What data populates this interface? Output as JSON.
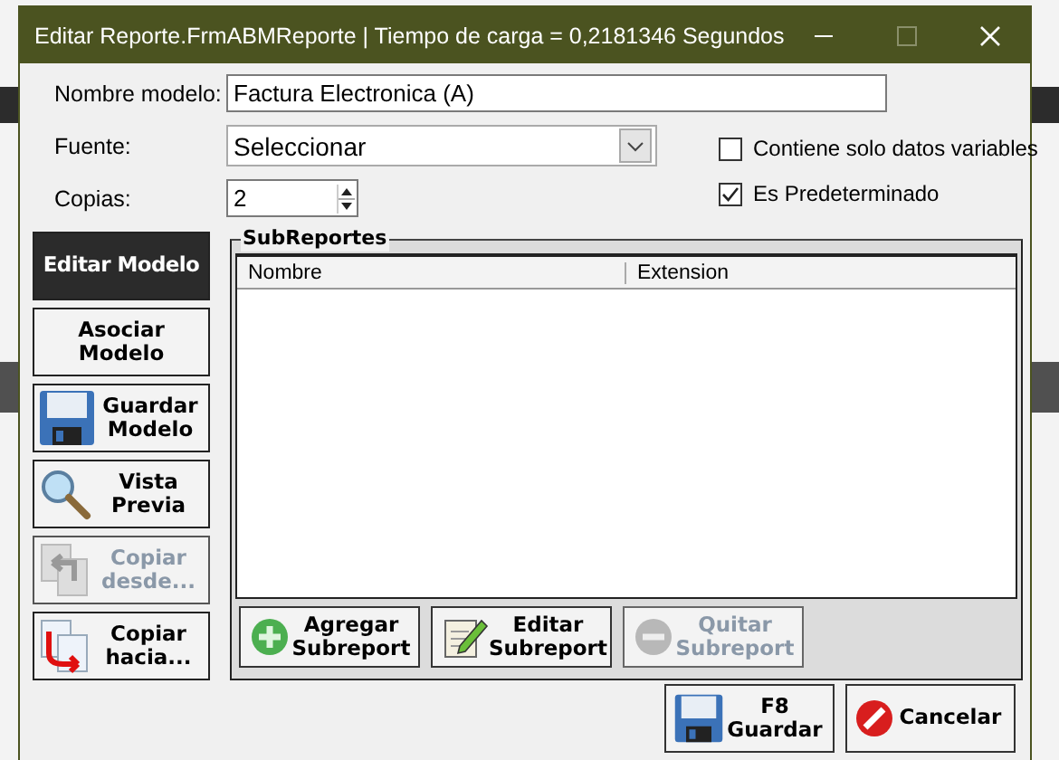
{
  "window": {
    "title": "Editar Reporte.FrmABMReporte | Tiempo de carga = 0,2181346 Segundos"
  },
  "fields": [
    {
      "kind": "text",
      "label": "Nombre modelo:",
      "value": "Factura Electronica (A)"
    },
    {
      "kind": "select",
      "label": "Fuente:",
      "value": "Seleccionar"
    },
    {
      "kind": "spin",
      "label": "Copias:",
      "value": "2"
    }
  ],
  "checkboxes": [
    {
      "label": "Contiene solo datos variables",
      "checked": false
    },
    {
      "label": "Es Predeterminado",
      "checked": true
    }
  ],
  "side_buttons": [
    {
      "label": "Editar Modelo",
      "kind": "plain",
      "selected": true,
      "disabled": false
    },
    {
      "label": "Asociar\nModelo",
      "kind": "plain",
      "selected": false,
      "disabled": false
    },
    {
      "label": "Guardar\nModelo",
      "kind": "save",
      "selected": false,
      "disabled": false
    },
    {
      "label": "Vista\nPrevia",
      "kind": "preview",
      "selected": false,
      "disabled": false
    },
    {
      "label": "Copiar\ndesde...",
      "kind": "copy-from",
      "selected": false,
      "disabled": true
    },
    {
      "label": "Copiar\nhacia...",
      "kind": "copy-to",
      "selected": false,
      "disabled": false
    }
  ],
  "subreportes": {
    "title": "SubReportes",
    "columns": [
      "Nombre",
      "Extension"
    ],
    "buttons": [
      {
        "label": "Agregar\nSubreport",
        "kind": "add",
        "disabled": false
      },
      {
        "label": "Editar\nSubreport",
        "kind": "edit",
        "disabled": false
      },
      {
        "label": "Quitar\nSubreport",
        "kind": "remove",
        "disabled": true
      }
    ]
  },
  "footer_buttons": [
    {
      "label": "F8\nGuardar",
      "kind": "save"
    },
    {
      "label": "Cancelar",
      "kind": "cancel"
    }
  ]
}
